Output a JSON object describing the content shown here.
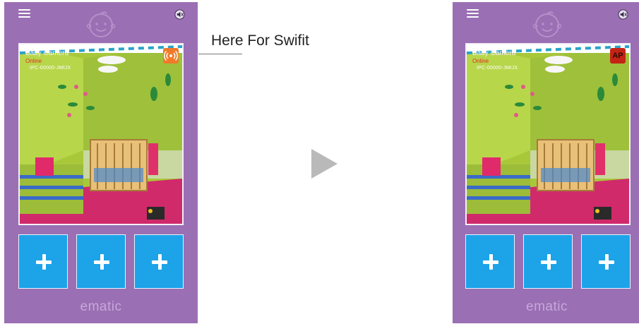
{
  "callout": {
    "text": "Here For Swifit"
  },
  "screens": [
    {
      "camera": {
        "name": "Baby Camera",
        "status": "Online",
        "id": "IPC-00000-JMIJX"
      },
      "mode_icon": "wifi-signal-icon",
      "brand": "ematic"
    },
    {
      "camera": {
        "name": "Baby Camera",
        "status": "Online",
        "id": "IPC-00000-JMIJX"
      },
      "mode_icon": "ap-mode-icon",
      "mode_label": "AP",
      "brand": "ematic"
    }
  ],
  "colors": {
    "phone_background": "#9a6fb3",
    "add_button": "#1da3e8",
    "status_online": "#e62a2a",
    "wifi_icon": "#f07a2a",
    "ap_icon": "#c42415"
  },
  "icons": [
    "menu-icon",
    "baby-face-logo-icon",
    "speaker-mute-icon",
    "plus-icon",
    "play-arrow-icon"
  ]
}
